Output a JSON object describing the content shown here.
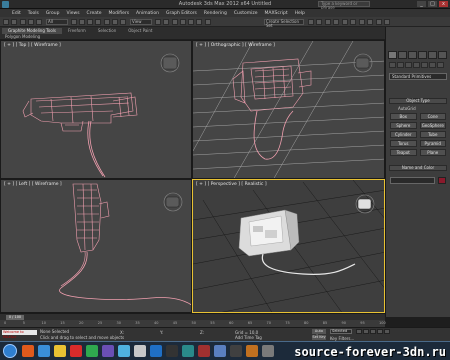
{
  "window": {
    "title": "Autodesk 3ds Max 2012 x64     Untitled",
    "infocenter_placeholder": "Type a keyword or phrase",
    "controls": [
      "_",
      "□",
      "x"
    ]
  },
  "menubar": {
    "items": [
      "Edit",
      "Tools",
      "Group",
      "Views",
      "Create",
      "Modifiers",
      "Animation",
      "Graph Editors",
      "Rendering",
      "Customize",
      "MAXScript",
      "Help"
    ]
  },
  "toolbar": {
    "selection_filter": "All",
    "reference_coord": "View",
    "named_selection": "Create Selection Set"
  },
  "ribbon": {
    "tabs": [
      "Graphite Modeling Tools",
      "Freeform",
      "Selection",
      "Object Paint"
    ],
    "active_tab": 0,
    "panel": "Polygon Modeling"
  },
  "viewports": {
    "top": "[ + ] [ Top ] [ Wireframe ]",
    "ortho": "[ + ] [ Orthographic ] [ Wireframe ]",
    "left": "[ + ] [ Left ] [ Wireframe ]",
    "persp": "[ + ] [ Perspective ] [ Realistic ]"
  },
  "command_panel": {
    "category": "Standard Primitives",
    "object_type_header": "Object Type",
    "autogrid": "AutoGrid",
    "buttons": [
      "Box",
      "Cone",
      "Sphere",
      "GeoSphere",
      "Cylinder",
      "Tube",
      "Torus",
      "Pyramid",
      "Teapot",
      "Plane"
    ],
    "name_color_header": "Name and Color",
    "color": "#8a1a2c"
  },
  "timeline": {
    "frame_label": "0 / 100",
    "ticks": [
      "0",
      "5",
      "10",
      "15",
      "20",
      "25",
      "30",
      "35",
      "40",
      "45",
      "50",
      "55",
      "60",
      "65",
      "70",
      "75",
      "80",
      "85",
      "90",
      "95",
      "100"
    ]
  },
  "statusbar": {
    "maxscript": "Welcome to MAXScr",
    "status": "None Selected",
    "prompt": "Click and drag to select and move objects",
    "x_label": "X:",
    "y_label": "Y:",
    "z_label": "Z:",
    "grid": "Grid = 10,0",
    "add_time_tag": "Add Time Tag",
    "auto_key": "Auto Key",
    "selected": "Selected",
    "set_key": "Set Key",
    "key_filters": "Key Filters..."
  },
  "taskbar": {
    "watermark": "source-forever-3dn.ru",
    "icon_colors": [
      "#e05a1c",
      "#3a8fd8",
      "#e8c233",
      "#d92b2b",
      "#2fa84f",
      "#6a4fb5",
      "#4fb2e0",
      "#c8c8c8",
      "#1f6fc5",
      "#333333",
      "#2a8a8a",
      "#a03030",
      "#5a7fbf",
      "#404040",
      "#c07020",
      "#7a7a7a"
    ]
  }
}
